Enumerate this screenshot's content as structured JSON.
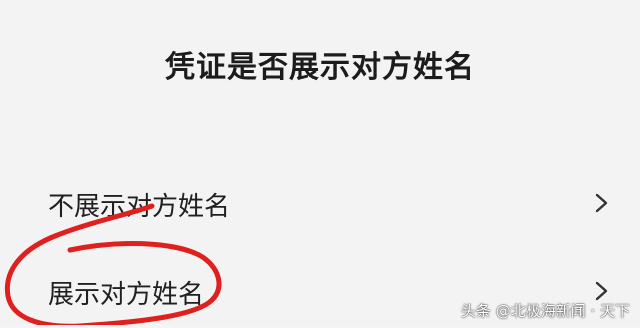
{
  "dialog": {
    "title": "凭证是否展示对方姓名",
    "options": [
      {
        "label": "不展示对方姓名",
        "chevron_icon": "chevron-right-icon"
      },
      {
        "label": "展示对方姓名",
        "chevron_icon": "chevron-right-icon"
      }
    ]
  },
  "annotation": {
    "shape": "hand-drawn-loop",
    "color": "#e0201e"
  },
  "watermark": {
    "text": "头条 @北极海新闻 · 天下"
  }
}
